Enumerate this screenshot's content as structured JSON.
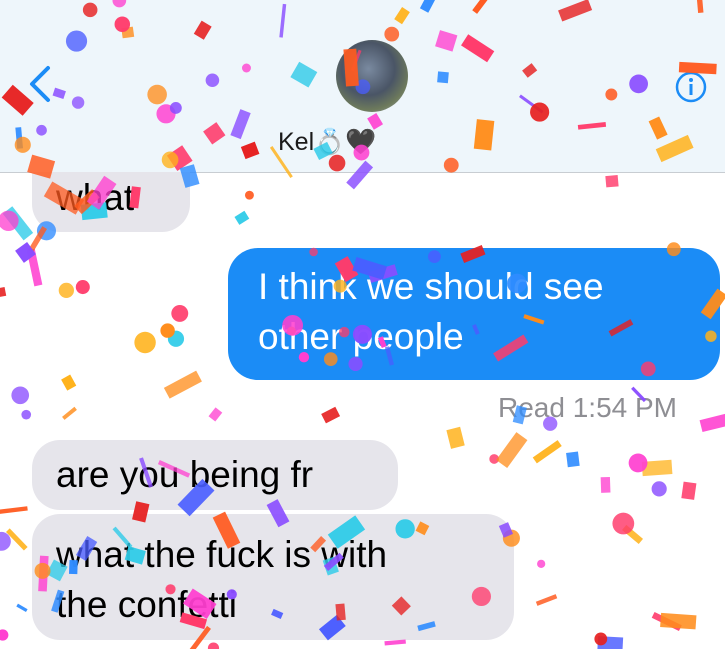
{
  "header": {
    "contact_name": "Kel",
    "name_emoji": "💍🖤",
    "back_icon": "chevron-left-icon",
    "info_icon": "info-icon",
    "accent_color": "#1b8cf6"
  },
  "messages": [
    {
      "direction": "incoming",
      "text": "what"
    },
    {
      "direction": "outgoing",
      "lines": [
        "I think we should see",
        "other people"
      ]
    },
    {
      "direction": "incoming",
      "text": "are you being fr"
    },
    {
      "direction": "incoming",
      "lines": [
        "what the fuck is with",
        "the confetti"
      ]
    }
  ],
  "receipt": {
    "label": "Read",
    "time": "1:54 PM"
  },
  "effect": "confetti"
}
